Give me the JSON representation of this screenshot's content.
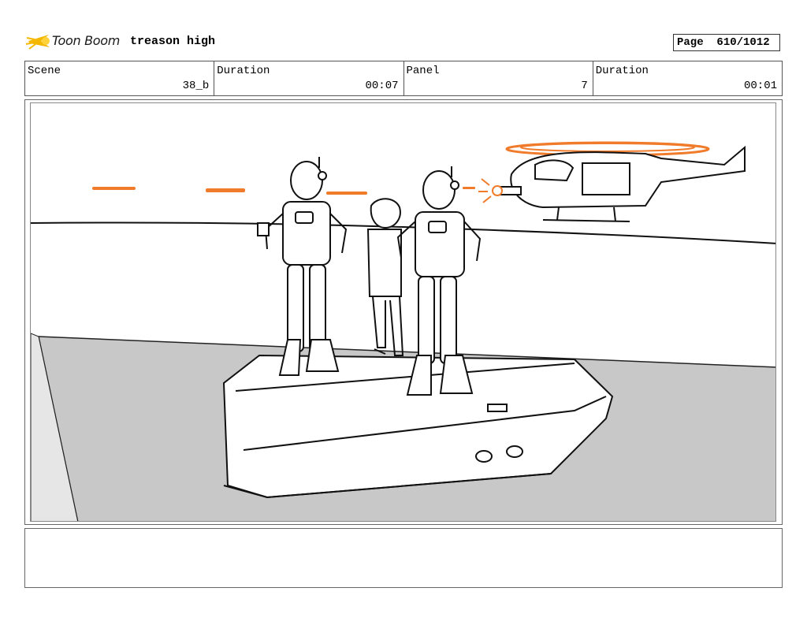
{
  "header": {
    "logo_text": "Toon Boom",
    "project_title": "treason high",
    "page_label": "Page",
    "page_value": "610/1012"
  },
  "info": {
    "scene_label": "Scene",
    "scene_value": "38_b",
    "scene_duration_label": "Duration",
    "scene_duration_value": "00:07",
    "panel_label": "Panel",
    "panel_value": "7",
    "panel_duration_label": "Duration",
    "panel_duration_value": "00:01"
  },
  "colors": {
    "accent_orange": "#f07b2a",
    "logo_yellow": "#f5b800",
    "floor_gray": "#c8c8c8"
  },
  "notes": {
    "text": ""
  }
}
